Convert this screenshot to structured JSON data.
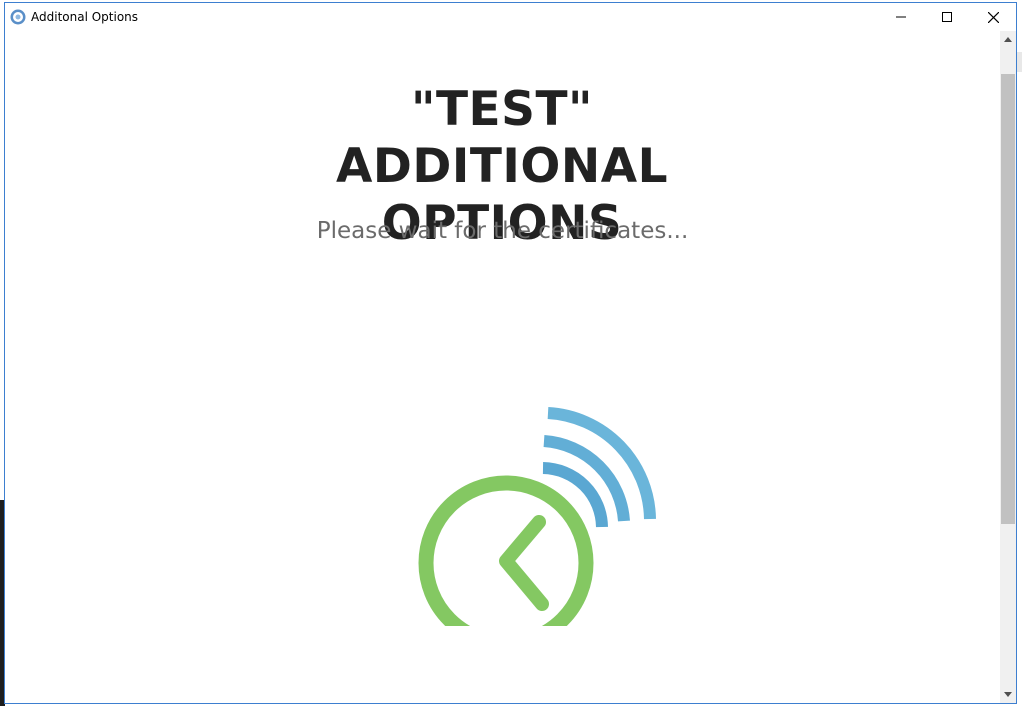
{
  "window": {
    "title": "Additonal Options",
    "controls": {
      "minimize_icon": "minimize-icon",
      "maximize_icon": "maximize-icon",
      "close_icon": "close-icon"
    }
  },
  "main": {
    "heading": "\"TEST\" ADDITIONAL OPTIONS",
    "subtitle": "Please wait for the certificates...",
    "logo_icon": "clock-signal-logo"
  },
  "colors": {
    "titlebar_border": "#3d7fd0",
    "heading": "#222222",
    "subtitle": "#6b6b6b",
    "logo_green": "#84c862",
    "logo_blue": "#5baad4"
  }
}
